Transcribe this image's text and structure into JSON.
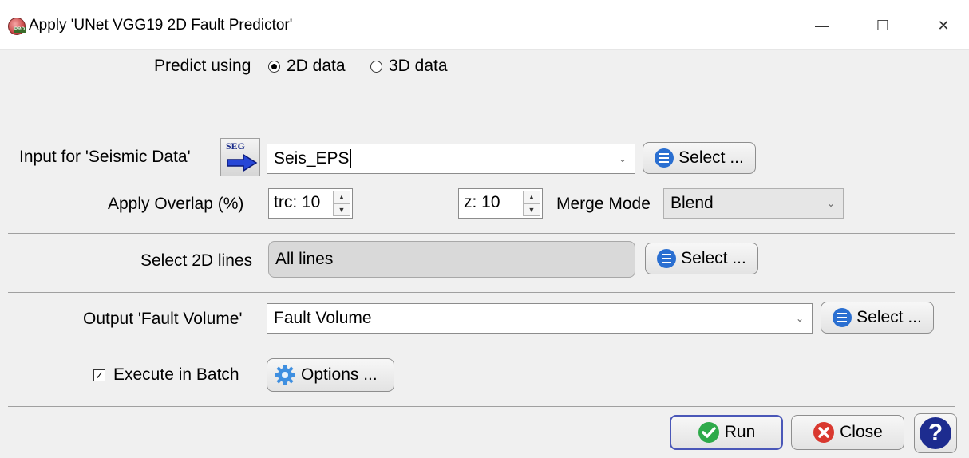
{
  "window": {
    "title": "Apply 'UNet VGG19 2D Fault Predictor'",
    "app_icon_badge": "PRO",
    "minimize": "—",
    "maximize": "☐",
    "close": "✕"
  },
  "predict": {
    "label": "Predict using",
    "option_2d": "2D data",
    "option_3d": "3D data",
    "selected": "2D data"
  },
  "input": {
    "label": "Input for 'Seismic Data'",
    "icon_text": "SEG",
    "value": "Seis_EPS",
    "select_label": "Select ..."
  },
  "overlap": {
    "label": "Apply Overlap (%)",
    "trc_value": "trc: 10",
    "z_value": "z: 10",
    "merge_label": "Merge Mode",
    "merge_value": "Blend"
  },
  "lines": {
    "label": "Select 2D lines",
    "value": "All lines",
    "select_label": "Select ..."
  },
  "output": {
    "label": "Output 'Fault Volume'",
    "value": "Fault Volume",
    "select_label": "Select ..."
  },
  "batch": {
    "label": "Execute in Batch",
    "checked": true,
    "options_label": "Options ..."
  },
  "footer": {
    "run_label": "Run",
    "close_label": "Close",
    "help_label": "?"
  },
  "colors": {
    "accent_blue": "#2a6fd1",
    "run_green": "#2eaa4a",
    "close_red": "#d9382f",
    "help_navy": "#1d2c8f"
  }
}
